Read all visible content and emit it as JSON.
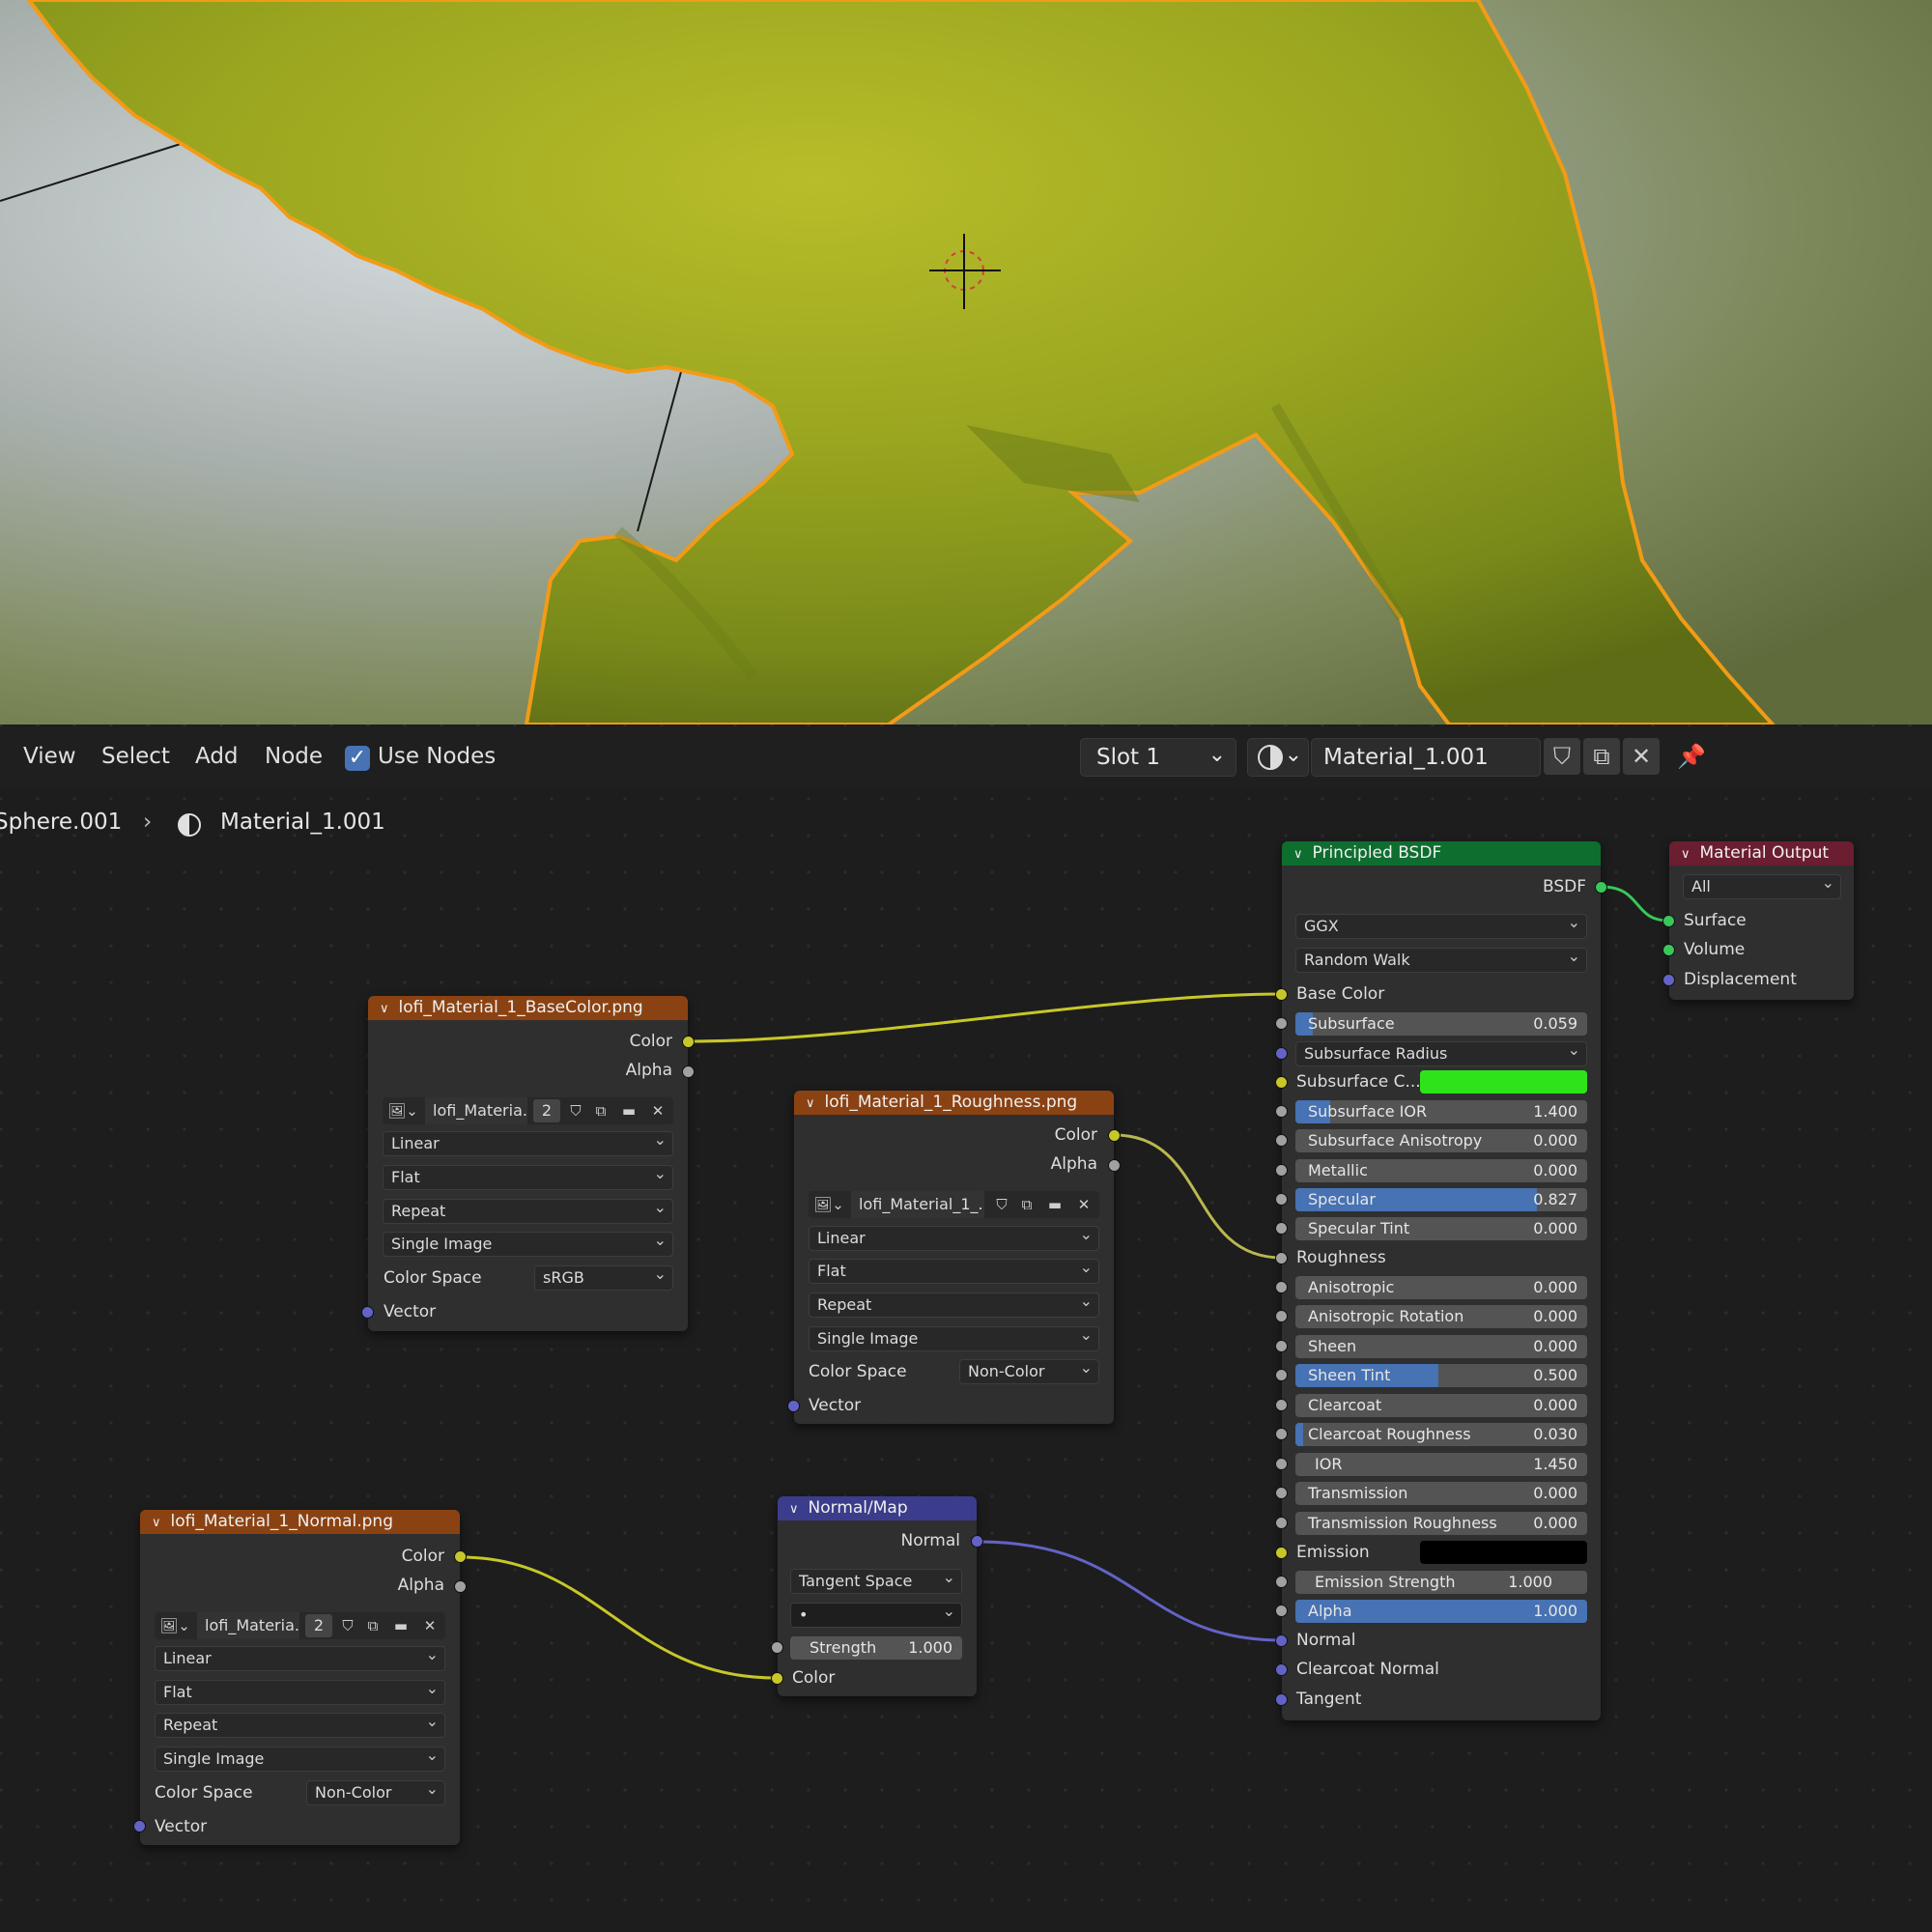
{
  "header": {
    "menu": [
      "View",
      "Select",
      "Add",
      "Node"
    ],
    "use_nodes_label": "Use Nodes",
    "use_nodes_checked": true,
    "slot": "Slot 1",
    "material_name": "Material_1.001"
  },
  "breadcrumb": {
    "object": "Sphere.001",
    "material": "Material_1.001"
  },
  "nodes": {
    "base_color": {
      "title": "lofi_Material_1_BaseColor.png",
      "out_color": "Color",
      "out_alpha": "Alpha",
      "image_name": "lofi_Materia...",
      "users": "2",
      "interpolation": "Linear",
      "projection": "Flat",
      "extension": "Repeat",
      "source": "Single Image",
      "color_space_label": "Color Space",
      "color_space": "sRGB",
      "in_vector": "Vector"
    },
    "roughness": {
      "title": "lofi_Material_1_Roughness.png",
      "out_color": "Color",
      "out_alpha": "Alpha",
      "image_name": "lofi_Material_1_...",
      "interpolation": "Linear",
      "projection": "Flat",
      "extension": "Repeat",
      "source": "Single Image",
      "color_space_label": "Color Space",
      "color_space": "Non-Color",
      "in_vector": "Vector"
    },
    "normal_tex": {
      "title": "lofi_Material_1_Normal.png",
      "out_color": "Color",
      "out_alpha": "Alpha",
      "image_name": "lofi_Materia...",
      "users": "2",
      "interpolation": "Linear",
      "projection": "Flat",
      "extension": "Repeat",
      "source": "Single Image",
      "color_space_label": "Color Space",
      "color_space": "Non-Color",
      "in_vector": "Vector"
    },
    "normal_map": {
      "title": "Normal/Map",
      "out_normal": "Normal",
      "space": "Tangent Space",
      "uv_field": "•",
      "strength_label": "Strength",
      "strength_value": "1.000",
      "in_color": "Color"
    },
    "bsdf": {
      "title": "Principled BSDF",
      "out": "BSDF",
      "distribution": "GGX",
      "subsurface_method": "Random Walk",
      "base_color": "Base Color",
      "subsurface": {
        "label": "Subsurface",
        "value": "0.059",
        "fill": 0.059
      },
      "subsurface_radius": "Subsurface Radius",
      "subsurface_color_label": "Subsurface C...",
      "subsurface_color": "#2fe31b",
      "subsurface_ior": {
        "label": "Subsurface IOR",
        "value": "1.400",
        "fill": 0.12
      },
      "subsurface_anisotropy": {
        "label": "Subsurface Anisotropy",
        "value": "0.000"
      },
      "metallic": {
        "label": "Metallic",
        "value": "0.000"
      },
      "specular": {
        "label": "Specular",
        "value": "0.827",
        "fill": 0.827
      },
      "specular_tint": {
        "label": "Specular Tint",
        "value": "0.000"
      },
      "roughness": "Roughness",
      "anisotropic": {
        "label": "Anisotropic",
        "value": "0.000"
      },
      "anisotropic_rotation": {
        "label": "Anisotropic Rotation",
        "value": "0.000"
      },
      "sheen": {
        "label": "Sheen",
        "value": "0.000"
      },
      "sheen_tint": {
        "label": "Sheen Tint",
        "value": "0.500",
        "fill": 0.5
      },
      "clearcoat": {
        "label": "Clearcoat",
        "value": "0.000"
      },
      "clearcoat_roughness": {
        "label": "Clearcoat Roughness",
        "value": "0.030",
        "fill": 0.03
      },
      "ior": {
        "label": "IOR",
        "value": "1.450"
      },
      "transmission": {
        "label": "Transmission",
        "value": "0.000"
      },
      "transmission_roughness": {
        "label": "Transmission Roughness",
        "value": "0.000"
      },
      "emission_label": "Emission",
      "emission_color": "#000000",
      "emission_strength": {
        "label": "Emission Strength",
        "value": "1.000"
      },
      "alpha": {
        "label": "Alpha",
        "value": "1.000",
        "fill": 1.0
      },
      "normal": "Normal",
      "clearcoat_normal": "Clearcoat Normal",
      "tangent": "Tangent"
    },
    "output": {
      "title": "Material Output",
      "target": "All",
      "surface": "Surface",
      "volume": "Volume",
      "displacement": "Displacement"
    }
  },
  "colors": {
    "texture_header": "#8b4212",
    "shader_header": "#0e6e2f",
    "output_header": "#6b1e30",
    "vector_header": "#3c3c8c",
    "selection_outline": "#f29b16",
    "slider_fill": "#4772b3"
  },
  "icons": {
    "material_sphere": "material-icon",
    "pin": "pin-icon",
    "shield": "fake-user-icon",
    "duplicate": "duplicate-icon",
    "close": "close-icon",
    "folder": "folder-icon",
    "image": "image-icon"
  }
}
